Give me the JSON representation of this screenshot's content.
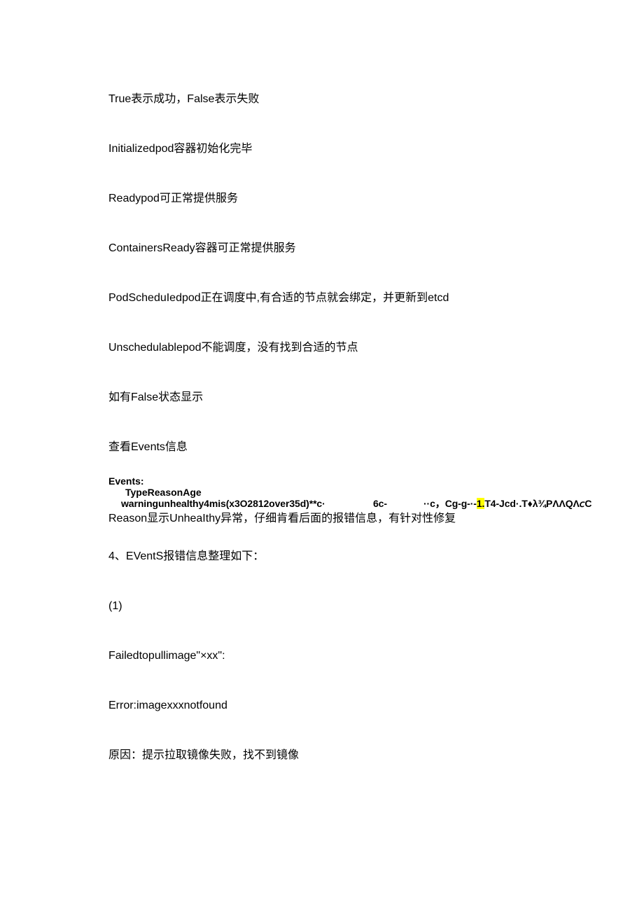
{
  "p1": "True表示成功，False表示失败",
  "p2": "Initializedpod容器初始化完毕",
  "p3": "Readypod可正常提供服务",
  "p4": "ContainersReady容器可正常提供服务",
  "p5": "PodScheduIedpod正在调度中,有合适的节点就会绑定，并更新到etcd",
  "p6": "Unschedulablepod不能调度，没有找到合适的节点",
  "p7": "如有False状态显示",
  "p8": "查看Events信息",
  "events_label": "Events:",
  "events_header": "TypeReasonAge",
  "events_warn_pre": "warningunhealthy4mis(x3O2812over35d)**c·",
  "events_warn_mid1": "6c-",
  "events_warn_mid2": "··c，Cg-g-·-",
  "events_warn_hl": "1.",
  "events_warn_post": "T4-Jcd·.T♦λ¾PΛΛQΛ𝘤C",
  "p9": "Reason显示UnheaIthy异常，仔细肯看后面的报错信息，有针对性修复",
  "p10": "4、EVentS报错信息整理如下：",
  "p11": "(1)",
  "p12": "Failedtopullimage\"×xx\":",
  "p13": "Error:imagexxxnotfound",
  "p14": "原因：提示拉取镜像失败，找不到镜像"
}
